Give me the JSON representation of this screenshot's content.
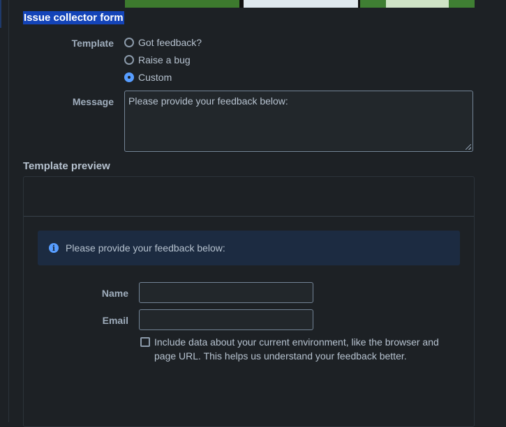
{
  "form": {
    "section_title": "Issue collector form",
    "template_label": "Template",
    "template_options": [
      {
        "label": "Got feedback?",
        "selected": false
      },
      {
        "label": "Raise a bug",
        "selected": false
      },
      {
        "label": "Custom",
        "selected": true
      }
    ],
    "message_label": "Message",
    "message_value": "Please provide your feedback below:"
  },
  "preview": {
    "title": "Template preview",
    "banner_text": "Please provide your feedback below:",
    "name_label": "Name",
    "email_label": "Email",
    "include_env_text": "Include data about your current environment, like the browser and page URL. This helps us understand your feedback better."
  },
  "colors": {
    "accent": "#579dff",
    "selection_highlight": "#1444b8",
    "background": "#1d2125",
    "info_banner": "#1c2b41"
  },
  "icons": {
    "radio": "radio-icon",
    "info": "info-icon",
    "checkbox": "checkbox-icon",
    "resize": "resize-grip-icon"
  }
}
